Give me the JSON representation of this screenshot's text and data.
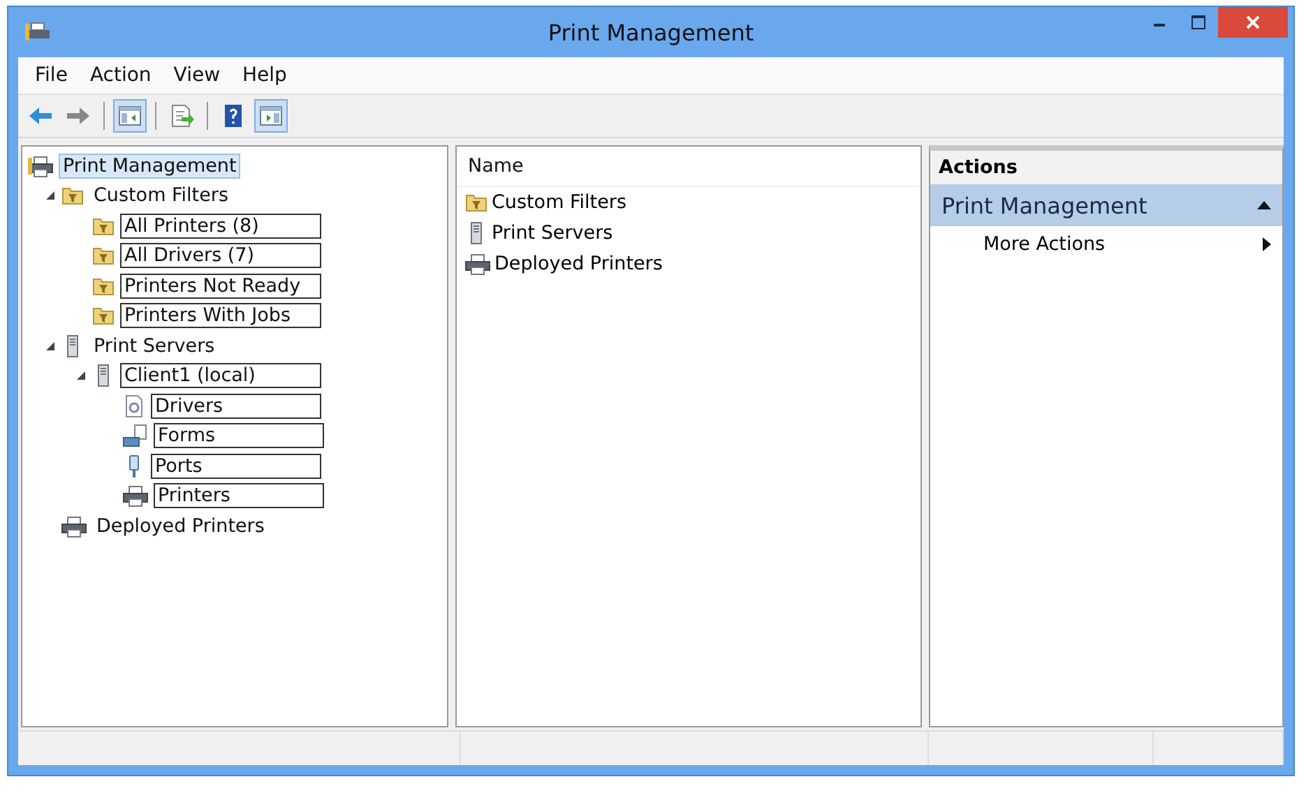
{
  "window": {
    "title": "Print Management"
  },
  "menu": [
    {
      "label": "File"
    },
    {
      "label": "Action"
    },
    {
      "label": "View"
    },
    {
      "label": "Help"
    }
  ],
  "toolbar": [
    {
      "kind": "back",
      "selected": false
    },
    {
      "kind": "forward",
      "selected": false
    },
    {
      "kind": "sep"
    },
    {
      "kind": "tree-pane",
      "selected": true
    },
    {
      "kind": "sep"
    },
    {
      "kind": "export",
      "selected": false
    },
    {
      "kind": "sep"
    },
    {
      "kind": "help",
      "selected": false
    },
    {
      "kind": "action-pane",
      "selected": true
    }
  ],
  "tree": [
    {
      "label": "Print Management",
      "kind": "printer-app",
      "selected": true,
      "outlined": false,
      "children": [
        {
          "label": "Custom Filters",
          "kind": "filter-folder",
          "selected": false,
          "outlined": false,
          "expanded": true,
          "children": [
            {
              "label": "All Printers (8)",
              "kind": "filter-folder",
              "selected": false,
              "outlined": true
            },
            {
              "label": "All Drivers (7)",
              "kind": "filter-folder",
              "selected": false,
              "outlined": true
            },
            {
              "label": "Printers Not Ready",
              "kind": "filter-folder",
              "selected": false,
              "outlined": true
            },
            {
              "label": "Printers With Jobs",
              "kind": "filter-folder",
              "selected": false,
              "outlined": true
            }
          ]
        },
        {
          "label": "Print Servers",
          "kind": "server",
          "selected": false,
          "outlined": false,
          "expanded": true,
          "children": [
            {
              "label": "Client1 (local)",
              "kind": "server",
              "selected": false,
              "outlined": true,
              "expanded": true,
              "children": [
                {
                  "label": "Drivers",
                  "kind": "drivers",
                  "selected": false,
                  "outlined": true
                },
                {
                  "label": "Forms",
                  "kind": "forms",
                  "selected": false,
                  "outlined": true
                },
                {
                  "label": "Ports",
                  "kind": "ports",
                  "selected": false,
                  "outlined": true
                },
                {
                  "label": "Printers",
                  "kind": "printer",
                  "selected": false,
                  "outlined": true
                }
              ]
            }
          ]
        },
        {
          "label": "Deployed Printers",
          "kind": "printer",
          "selected": false,
          "outlined": false
        }
      ]
    }
  ],
  "list": {
    "column": "Name",
    "items": [
      {
        "label": "Custom Filters",
        "kind": "filter-folder"
      },
      {
        "label": "Print Servers",
        "kind": "server"
      },
      {
        "label": "Deployed Printers",
        "kind": "printer"
      }
    ]
  },
  "actions": {
    "title": "Actions",
    "section": "Print Management",
    "expanded": true,
    "items": [
      {
        "label": "More Actions"
      }
    ]
  }
}
